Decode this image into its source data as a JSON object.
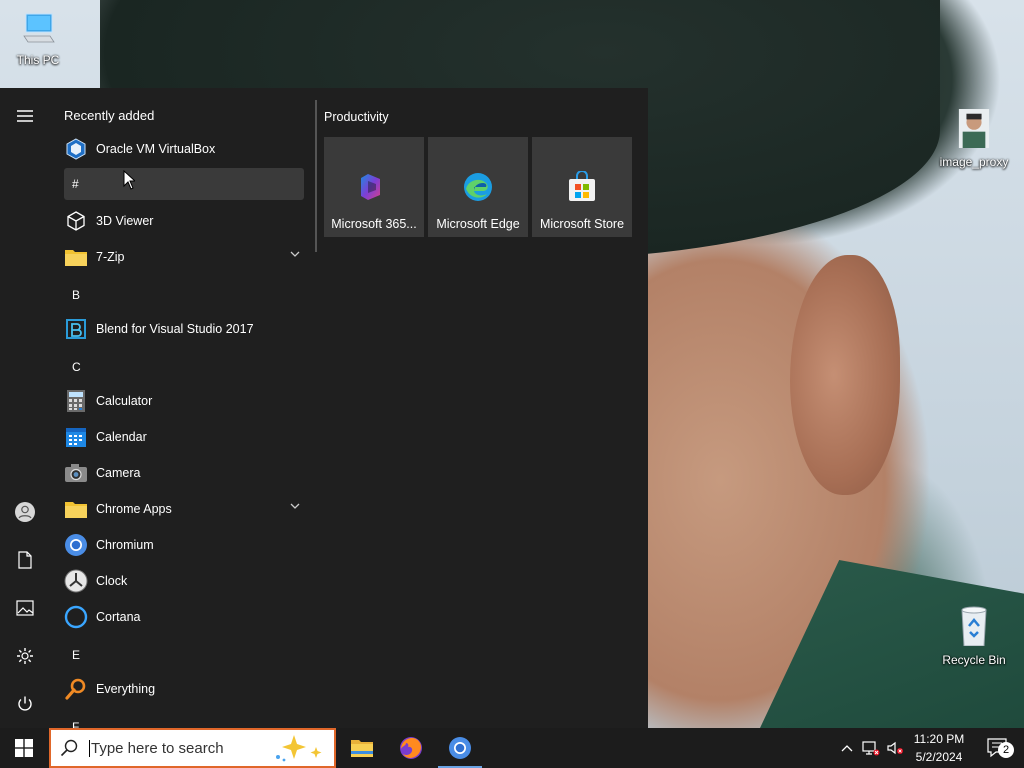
{
  "desktop": {
    "icons": [
      {
        "label": "This PC"
      },
      {
        "label": "image_proxy"
      },
      {
        "label": "Recycle Bin"
      }
    ]
  },
  "start_menu": {
    "recently_added_title": "Recently added",
    "recent_app": "Oracle VM VirtualBox",
    "groups": [
      {
        "letter": "#",
        "apps": [
          "3D Viewer",
          "7-Zip"
        ]
      },
      {
        "letter": "B",
        "apps": [
          "Blend for Visual Studio 2017"
        ]
      },
      {
        "letter": "C",
        "apps": [
          "Calculator",
          "Calendar",
          "Camera",
          "Chrome Apps",
          "Chromium",
          "Clock",
          "Cortana"
        ]
      },
      {
        "letter": "E",
        "apps": [
          "Everything"
        ]
      },
      {
        "letter": "F",
        "apps": []
      }
    ],
    "tiles_group_title": "Productivity",
    "tiles": [
      {
        "label": "Microsoft 365..."
      },
      {
        "label": "Microsoft Edge"
      },
      {
        "label": "Microsoft Store"
      }
    ]
  },
  "taskbar": {
    "search_placeholder": "Type here to search",
    "time": "11:20 PM",
    "date": "5/2/2024",
    "notification_count": "2"
  },
  "colors": {
    "start_bg": "#1f1f1f",
    "taskbar_bg": "#1c1c1c",
    "search_border": "#e0672a",
    "tile_bg": "#3a3a3a",
    "accent": "#6aa3e3"
  }
}
